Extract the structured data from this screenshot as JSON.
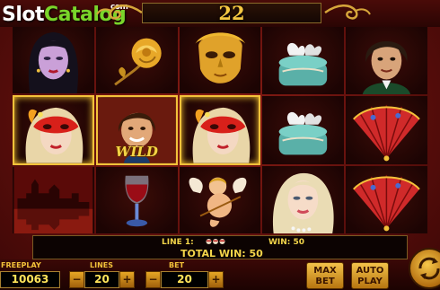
{
  "logo": {
    "part1": "Slot",
    "part2": "Catalog",
    "suffix": "com"
  },
  "counter": "22",
  "reels": [
    [
      {
        "symbol": "woman-dark-hair"
      },
      {
        "symbol": "venetian-mask-woman",
        "win": true
      },
      {
        "symbol": "venice-city"
      }
    ],
    [
      {
        "symbol": "golden-rose"
      },
      {
        "symbol": "wild-man",
        "win": true,
        "label": "WILD"
      },
      {
        "symbol": "wine-glass"
      }
    ],
    [
      {
        "symbol": "golden-mask"
      },
      {
        "symbol": "venetian-mask-woman",
        "win": true
      },
      {
        "symbol": "cupid"
      }
    ],
    [
      {
        "symbol": "doves-box"
      },
      {
        "symbol": "doves-box"
      },
      {
        "symbol": "blonde-woman"
      }
    ],
    [
      {
        "symbol": "man-portrait"
      },
      {
        "symbol": "red-fan"
      },
      {
        "symbol": "red-fan"
      }
    ]
  ],
  "info": {
    "line_label": "LINE 1:",
    "line_win_label": "WIN: 50",
    "total_win_label": "TOTAL WIN: 50"
  },
  "controls": {
    "freeplay_label": "FREEPLAY",
    "freeplay_value": "10063",
    "lines_label": "LINES",
    "lines_value": "20",
    "bet_label": "BET",
    "bet_value": "20",
    "minus": "−",
    "plus": "+",
    "maxbet_label": "MAX BET",
    "autoplay_label": "AUTO PLAY",
    "spin_icon": "spin-arrows-icon"
  },
  "colors": {
    "accent_gold": "#f3c23a",
    "logo_green": "#7ad52a",
    "background_red": "#5e0f0c"
  }
}
